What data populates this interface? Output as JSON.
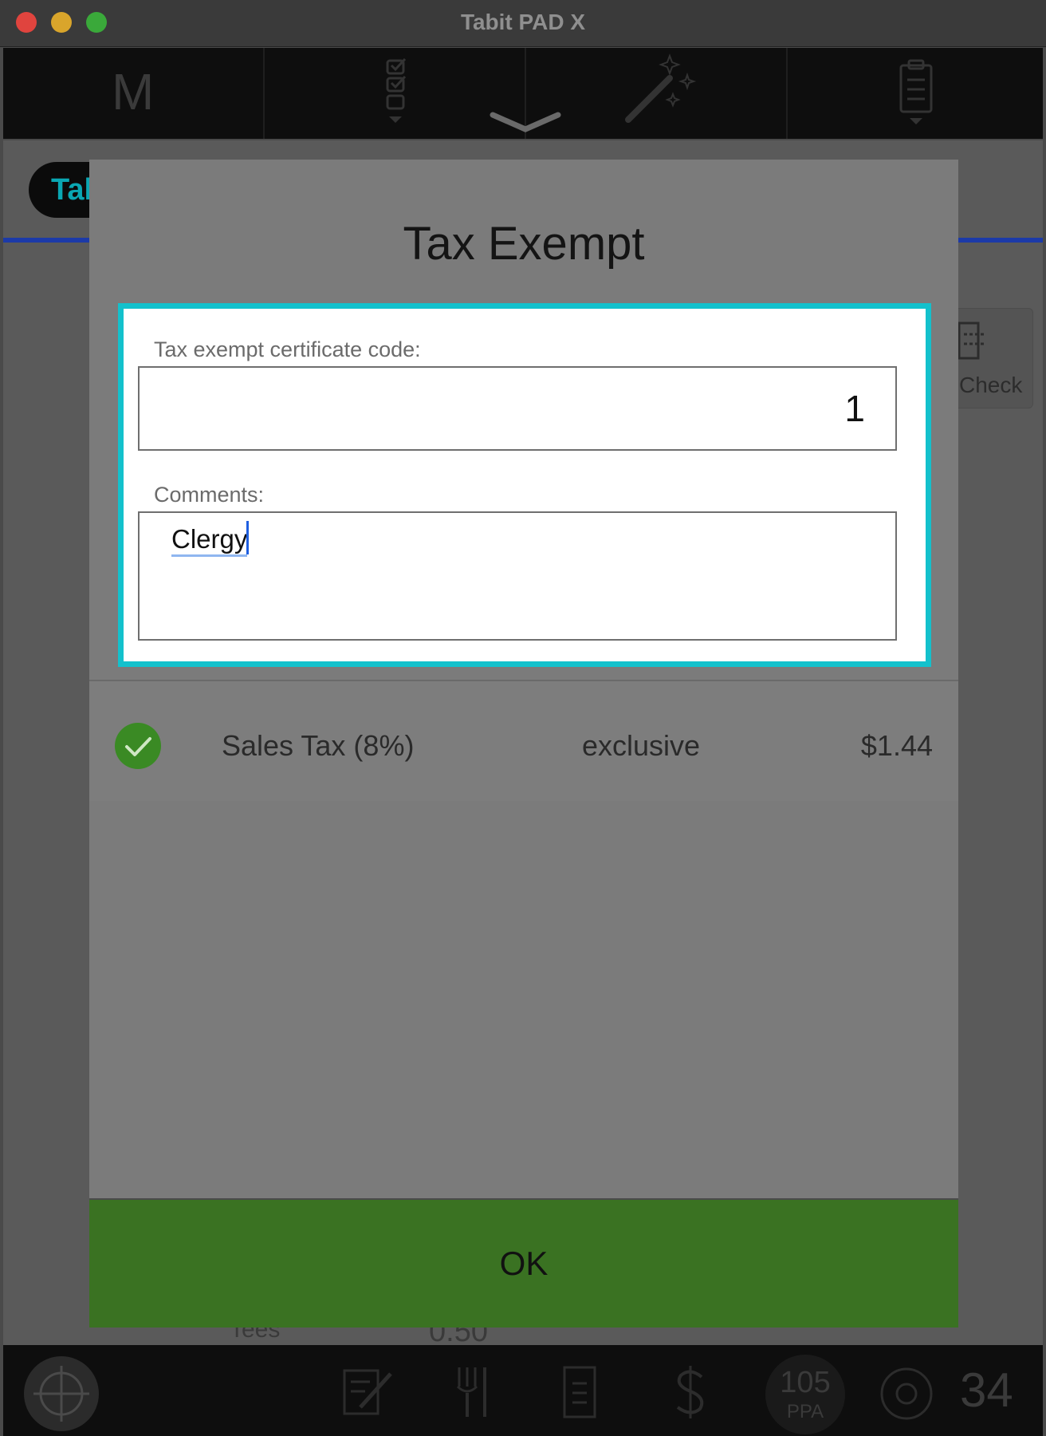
{
  "window": {
    "title": "Tabit PAD X"
  },
  "toolbar": {
    "m_label": "M"
  },
  "background": {
    "tab_pill": "Tal",
    "check_button": "Check",
    "partial_text_1": "Tees",
    "partial_text_2": "0.50"
  },
  "modal": {
    "title": "Tax Exempt",
    "certificate_label": "Tax exempt certificate code:",
    "certificate_value": "1",
    "comments_label": "Comments:",
    "comments_value": "Clergy",
    "tax_row": {
      "name": "Sales Tax (8%)",
      "type": "exclusive",
      "amount": "$1.44"
    },
    "ok_label": "OK"
  },
  "bottombar": {
    "ppa_value": "105",
    "ppa_label": "PPA",
    "count": "34"
  },
  "colors": {
    "accent_frame": "#13c1cc",
    "ok_green": "#3a7222",
    "check_green": "#3a8a24"
  }
}
